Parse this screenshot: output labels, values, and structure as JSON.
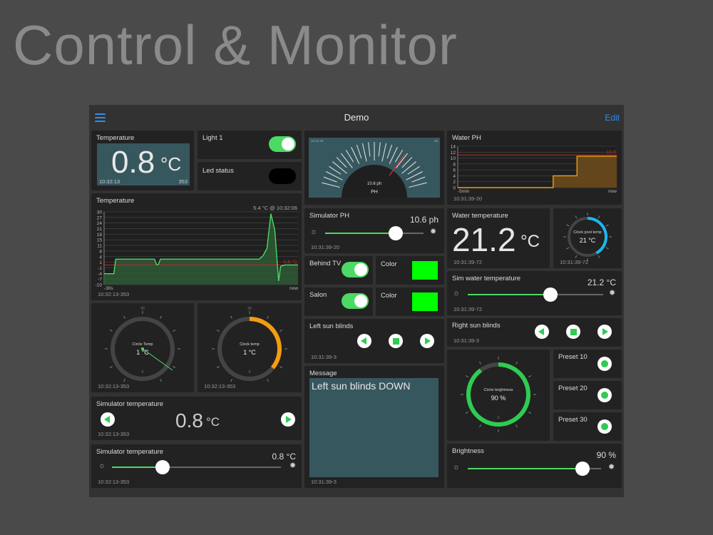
{
  "hero_title": "Control & Monitor",
  "app_title": "Demo",
  "edit_label": "Edit",
  "colors": {
    "accent": "#2d8cf0",
    "green": "#4cd964",
    "orange": "#f39c12",
    "cyan": "#1ab8f0",
    "teal_panel": "#37575e"
  },
  "temperature": {
    "label": "Temperature",
    "value": "0.8",
    "unit": "°C",
    "time": "10:32:13",
    "count": "353"
  },
  "light1": {
    "label": "Light 1",
    "on": true
  },
  "led": {
    "label": "Led status"
  },
  "ph_gauge": {
    "label": "PH",
    "value": "10.6 ph",
    "corner_left": "10:31:39",
    "corner_right": "35"
  },
  "water_ph": {
    "label": "Water PH",
    "time": "10:31:39-20",
    "marker": "10.6",
    "x_left": "-5min",
    "x_right": "now",
    "y_ticks": [
      "14",
      "12",
      "10",
      "8",
      "6",
      "4",
      "2",
      "0"
    ],
    "chart_data": {
      "type": "line",
      "ylim": [
        0,
        14
      ],
      "threshold": 11,
      "x": [
        0,
        0.6,
        0.6,
        0.75,
        0.75,
        1
      ],
      "y": [
        0,
        0,
        4,
        4,
        10.6,
        10.6
      ]
    }
  },
  "temp_chart": {
    "label": "Temperature",
    "legend": "5.4 °C @ 10:32:06",
    "marker": "0.8 °C",
    "time": "10:32:13-353",
    "x_left": "-30s",
    "x_right": "now",
    "y_ticks": [
      "30",
      "27",
      "24",
      "21",
      "18",
      "15",
      "11",
      "8",
      "4",
      "1",
      "-1",
      "-4",
      "-7",
      "-10"
    ],
    "chart_data": {
      "type": "area",
      "ylim": [
        -10,
        30
      ],
      "threshold": 0.8,
      "x": [
        0,
        0.05,
        0.06,
        0.13,
        0.14,
        0.26,
        0.27,
        0.28,
        0.29,
        0.3,
        0.5,
        0.78,
        0.8,
        0.82,
        0.84,
        0.86,
        0.88,
        0.9,
        0.91,
        0.93,
        0.95,
        1
      ],
      "y": [
        -4,
        -4,
        4,
        4,
        4,
        4,
        1,
        1,
        4,
        4,
        4,
        4,
        4,
        6,
        10,
        29,
        20,
        -8,
        0,
        0.8,
        0.8,
        0.8
      ]
    }
  },
  "sim_ph": {
    "label": "Simulator PH",
    "value": "10.6 ph",
    "time": "10:31:39-20",
    "fraction": 0.72
  },
  "water_temp": {
    "label": "Water temperature",
    "value": "21.2",
    "unit": "°C",
    "time": "10:31:39-72"
  },
  "clock_pool": {
    "label": "Clock pool temp",
    "value": "21 °C",
    "time": "10:31:39-72",
    "fraction": 0.42
  },
  "behind_tv": {
    "label": "Behind TV",
    "on": true
  },
  "salon": {
    "label": "Salon",
    "on": true
  },
  "color1": {
    "label": "Color",
    "hex": "#00ff00"
  },
  "color2": {
    "label": "Color",
    "hex": "#00ff00"
  },
  "sim_water_temp": {
    "label": "Sim water temperature",
    "value": "21.2 °C",
    "time": "10:31:39-72",
    "fraction": 0.61
  },
  "circle_temp": {
    "label": "Circle Temp",
    "value": "1 °C",
    "time": "10:32:13-353",
    "top": "30",
    "bottom": "0"
  },
  "clock_temp": {
    "label": "Clock temp",
    "value": "1 °C",
    "time": "10:32:13-353",
    "fraction": 0.36,
    "top": "30",
    "bottom": "0"
  },
  "left_blinds": {
    "label": "Left sun blinds",
    "time": "10:31:39-3"
  },
  "right_blinds": {
    "label": "Right sun blinds",
    "time": "10:31:39-3"
  },
  "message": {
    "label": "Message",
    "text": "Left sun blinds DOWN",
    "time": "10:31:39-3"
  },
  "circle_brightness": {
    "label": "Circle brightness",
    "value": "90 %",
    "fraction": 0.9,
    "bottom": "0"
  },
  "presets": [
    {
      "label": "Preset 10"
    },
    {
      "label": "Preset 20"
    },
    {
      "label": "Preset 30"
    }
  ],
  "sim_temp_btn": {
    "label": "Simulator temperature",
    "value": "0.8",
    "unit": "°C",
    "time": "10:32:13-353"
  },
  "sim_temp_slider": {
    "label": "Simulator temperature",
    "value": "0.8 °C",
    "time": "10:32:13-353",
    "fraction": 0.3
  },
  "brightness": {
    "label": "Brightness",
    "value": "90 %",
    "fraction": 0.86
  }
}
